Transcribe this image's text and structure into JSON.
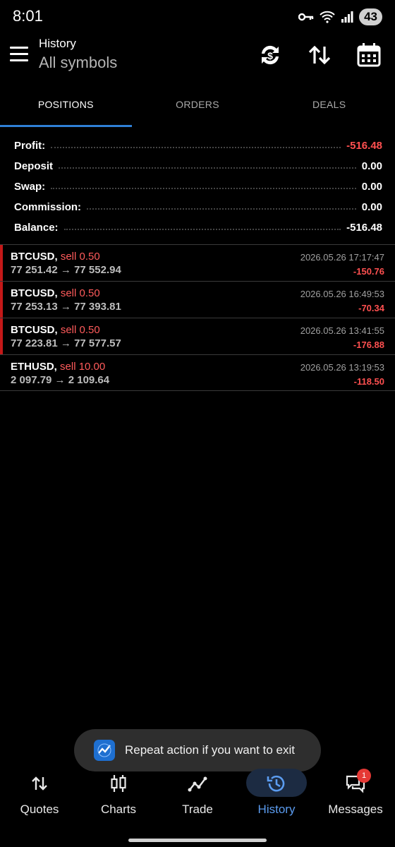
{
  "status_bar": {
    "time": "8:01",
    "battery": "43"
  },
  "header": {
    "title": "History",
    "subtitle": "All symbols"
  },
  "tabs": [
    {
      "label": "POSITIONS",
      "active": true
    },
    {
      "label": "ORDERS",
      "active": false
    },
    {
      "label": "DEALS",
      "active": false
    }
  ],
  "summary": [
    {
      "label": "Profit:",
      "value": "-516.48"
    },
    {
      "label": "Deposit",
      "value": "0.00"
    },
    {
      "label": "Swap:",
      "value": "0.00"
    },
    {
      "label": "Commission:",
      "value": "0.00"
    },
    {
      "label": "Balance:",
      "value": "-516.48"
    }
  ],
  "deals": [
    {
      "symbol": "BTCUSD,",
      "side": "sell 0.50",
      "prices": "77 251.42 → 77 552.94",
      "datetime": "2026.05.26 17:17:47",
      "pl": "-150.76"
    },
    {
      "symbol": "BTCUSD,",
      "side": "sell 0.50",
      "prices": "77 253.13 → 77 393.81",
      "datetime": "2026.05.26 16:49:53",
      "pl": "-70.34"
    },
    {
      "symbol": "BTCUSD,",
      "side": "sell 0.50",
      "prices": "77 223.81 → 77 577.57",
      "datetime": "2026.05.26 13:41:55",
      "pl": "-176.88"
    },
    {
      "symbol": "ETHUSD,",
      "side": "sell 10.00",
      "prices": "2 097.79 → 2 109.64",
      "datetime": "2026.05.26 13:19:53",
      "pl": "-118.50"
    }
  ],
  "toast": {
    "text": "Repeat action if you want to exit"
  },
  "nav": [
    {
      "label": "Quotes",
      "icon": "quotes-icon"
    },
    {
      "label": "Charts",
      "icon": "charts-icon"
    },
    {
      "label": "Trade",
      "icon": "trade-icon"
    },
    {
      "label": "History",
      "icon": "history-icon",
      "active": true
    },
    {
      "label": "Messages",
      "icon": "messages-icon",
      "badge": "1"
    }
  ],
  "colors": {
    "accent": "#2f7fd6",
    "loss": "#ff5050",
    "sell": "#ff5b5b",
    "row_marker": "#c41818"
  }
}
